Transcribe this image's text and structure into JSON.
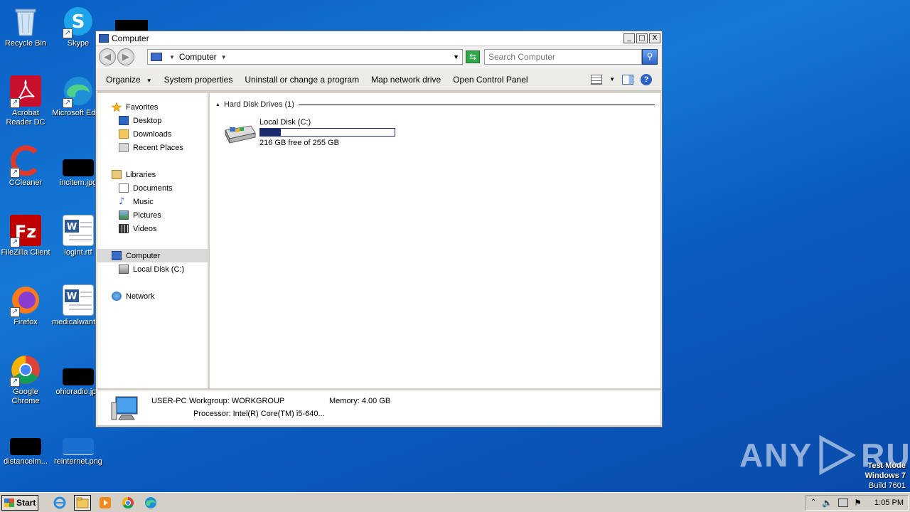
{
  "desktop": {
    "icons": [
      {
        "label": "Recycle Bin"
      },
      {
        "label": "Skype"
      },
      {
        "label": "Acrobat Reader DC"
      },
      {
        "label": "Microsoft Edge"
      },
      {
        "label": "CCleaner"
      },
      {
        "label": "incitem.jpg"
      },
      {
        "label": "FileZilla Client"
      },
      {
        "label": "logint.rtf"
      },
      {
        "label": "Firefox"
      },
      {
        "label": "medicalwant.rtf"
      },
      {
        "label": "Google Chrome"
      },
      {
        "label": "ohioradio.jpg"
      },
      {
        "label": "distanceim..."
      },
      {
        "label": "reinternet.png"
      }
    ]
  },
  "window": {
    "title": "Computer",
    "controls": {
      "minimize": "_",
      "maximize": "□",
      "close": "X"
    },
    "address": {
      "crumb": "Computer"
    },
    "search": {
      "placeholder": "Search Computer"
    },
    "commands": [
      {
        "label": "Organize"
      },
      {
        "label": "System properties"
      },
      {
        "label": "Uninstall or change a program"
      },
      {
        "label": "Map network drive"
      },
      {
        "label": "Open Control Panel"
      }
    ],
    "nav": {
      "favorites": "Favorites",
      "desktop": "Desktop",
      "downloads": "Downloads",
      "recent": "Recent Places",
      "libraries": "Libraries",
      "documents": "Documents",
      "music": "Music",
      "pictures": "Pictures",
      "videos": "Videos",
      "computer": "Computer",
      "local_disk": "Local Disk (C:)",
      "network": "Network"
    },
    "content": {
      "group_header": "Hard Disk Drives (1)",
      "drive": {
        "name": "Local Disk (C:)",
        "free_text": "216 GB free of 255 GB",
        "used_fraction": 0.153
      }
    },
    "status": {
      "pc_name": "USER-PC",
      "workgroup": "Workgroup: WORKGROUP",
      "memory": "Memory: 4.00 GB",
      "processor": "Processor: Intel(R) Core(TM) i5-640..."
    }
  },
  "taskbar": {
    "start_label": "Start",
    "clock": "1:05 PM"
  },
  "watermark": {
    "line1": "Test Mode",
    "line2": "Windows 7",
    "line3": "Build 7601",
    "anyrun_left": "ANY",
    "anyrun_right": "RUN"
  }
}
